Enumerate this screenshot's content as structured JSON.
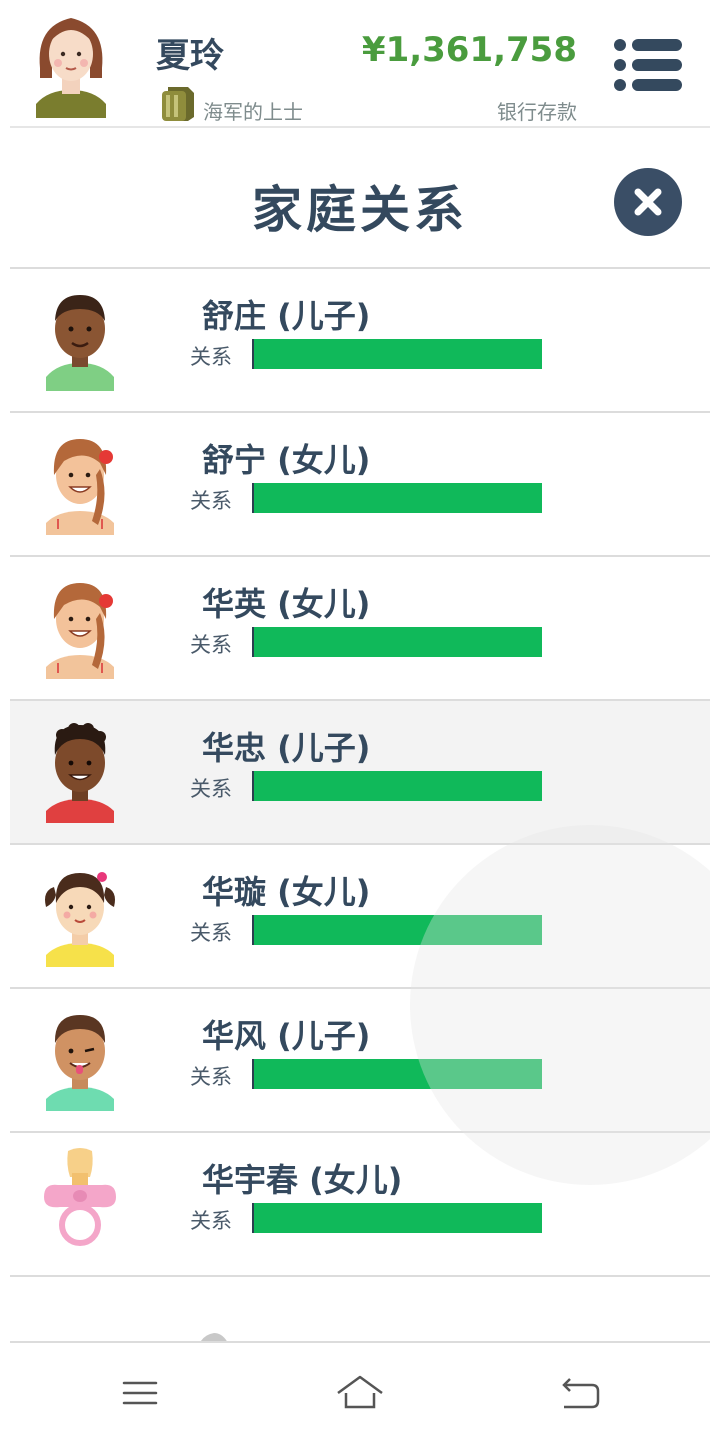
{
  "header": {
    "player_name": "夏玲",
    "job_title": "海军的上士",
    "money": "¥1,361,758",
    "money_label": "银行存款"
  },
  "page": {
    "title": "家庭关系"
  },
  "family": [
    {
      "name": "舒庄 (儿子)",
      "relation_label": "关系",
      "relation_level": 1.0,
      "avatar": "boy-dark-green-shirt"
    },
    {
      "name": "舒宁 (女儿)",
      "relation_label": "关系",
      "relation_level": 1.0,
      "avatar": "girl-braid-red-flower"
    },
    {
      "name": "华英 (女儿)",
      "relation_label": "关系",
      "relation_level": 1.0,
      "avatar": "girl-braid-red-flower"
    },
    {
      "name": "华忠 (儿子)",
      "relation_label": "关系",
      "relation_level": 1.0,
      "avatar": "boy-curly-red-shirt"
    },
    {
      "name": "华璇 (女儿)",
      "relation_label": "关系",
      "relation_level": 1.0,
      "avatar": "girl-pigtails-yellow"
    },
    {
      "name": "华风 (儿子)",
      "relation_label": "关系",
      "relation_level": 1.0,
      "avatar": "boy-winking-teal"
    },
    {
      "name": "华宇春 (女儿)",
      "relation_label": "关系",
      "relation_level": 1.0,
      "avatar": "baby-pacifier-icon"
    }
  ],
  "colors": {
    "text_dark": "#34495e",
    "money_green": "#4a9c3e",
    "bar_green": "#10b95a",
    "close_bg": "#3a4e66"
  },
  "icons": {
    "menu": "list-menu-icon",
    "close": "close-icon",
    "job": "military-rank-icon",
    "nav_menu": "hamburger-icon",
    "nav_home": "home-icon",
    "nav_back": "back-icon"
  }
}
